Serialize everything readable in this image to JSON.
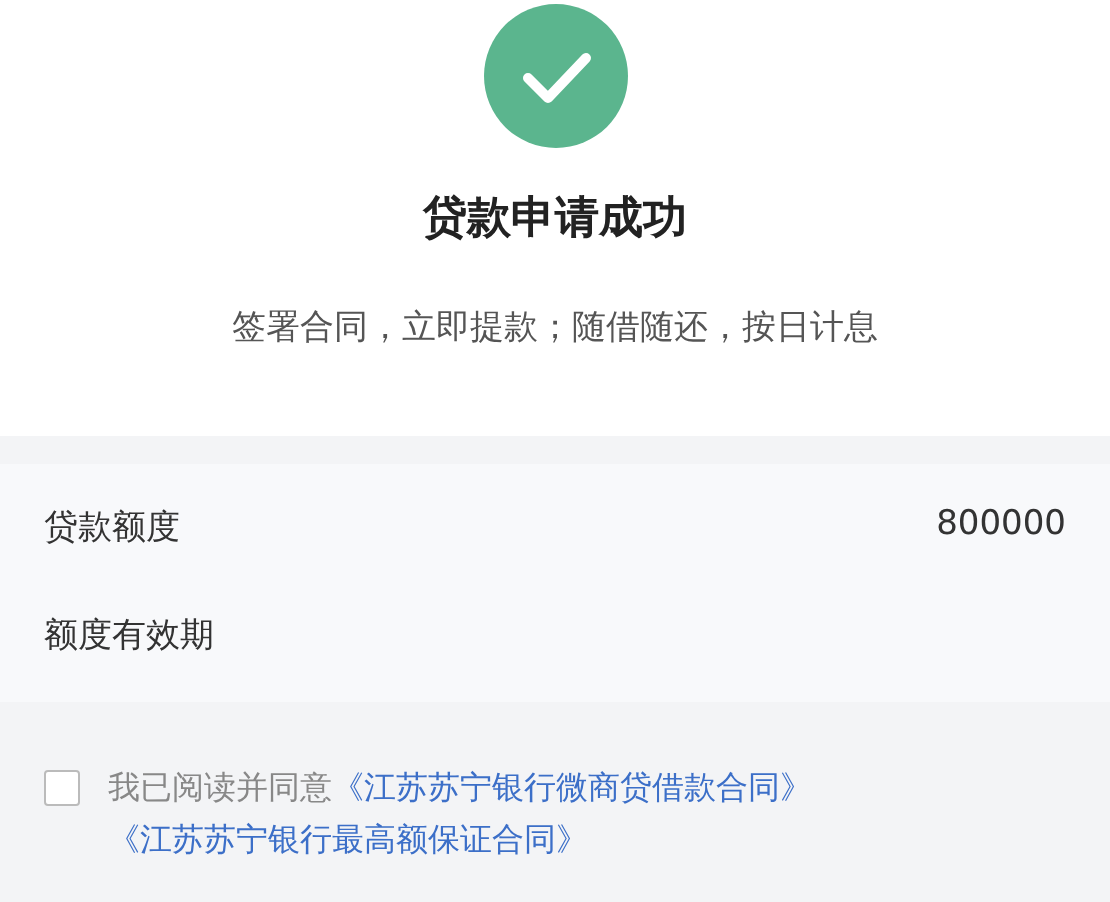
{
  "result": {
    "title": "贷款申请成功",
    "subtitle": "签署合同，立即提款；随借随还，按日计息"
  },
  "details": [
    {
      "label": "贷款额度",
      "value": "800000"
    },
    {
      "label": "额度有效期"
    }
  ],
  "agreement": {
    "checked": false,
    "text": "我已阅读并同意",
    "links": [
      "《江苏苏宁银行微商贷借款合同》",
      "《江苏苏宁银行最高额保证合同》"
    ]
  }
}
